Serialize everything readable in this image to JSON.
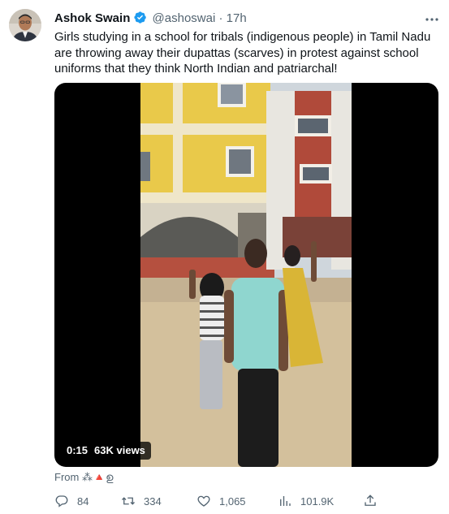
{
  "tweet": {
    "author_name": "Ashok Swain",
    "handle": "@ashoswai",
    "separator": "·",
    "time": "17h",
    "text": "Girls studying in a school for tribals (indigenous people) in Tamil Nadu are throwing away their dupattas (scarves) in protest against school uniforms that they think North Indian and patriarchal!",
    "more_icon": "more-horizontal-icon",
    "verified_icon": "verified-badge-icon"
  },
  "media": {
    "duration": "0:15",
    "views": "63K views"
  },
  "source": {
    "label": "From",
    "emoji_text": "⁂🔺ഉ"
  },
  "actions": {
    "reply_count": "84",
    "retweet_count": "334",
    "like_count": "1,065",
    "view_count": "101.9K"
  },
  "colors": {
    "secondary_text": "#536471",
    "verified_blue": "#1d9bf0",
    "primary_text": "#0f1419"
  }
}
